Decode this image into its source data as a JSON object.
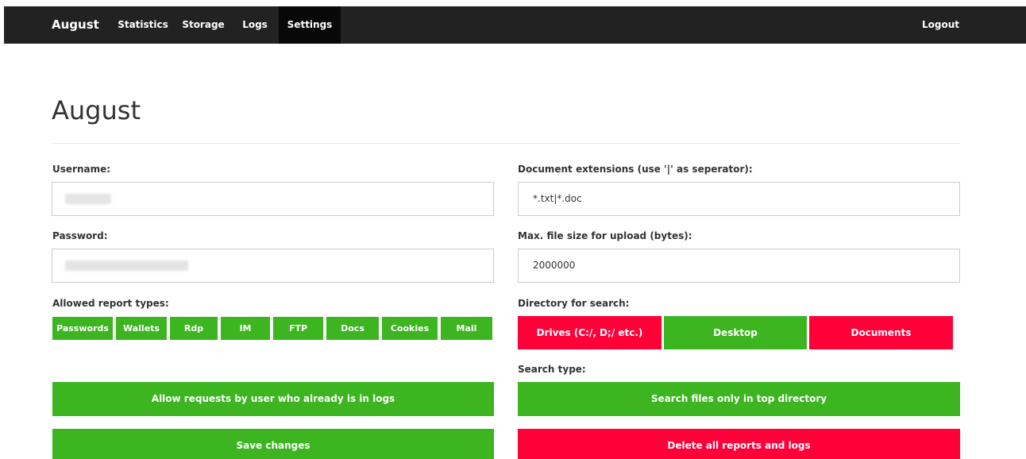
{
  "navbar": {
    "brand": "August",
    "links": [
      {
        "label": "Statistics",
        "active": false
      },
      {
        "label": "Storage",
        "active": false
      },
      {
        "label": "Logs",
        "active": false
      },
      {
        "label": "Settings",
        "active": true
      }
    ],
    "logout": "Logout"
  },
  "page": {
    "title": "August"
  },
  "left": {
    "username_label": "Username:",
    "password_label": "Password:",
    "report_types_label": "Allowed report types:",
    "report_types": [
      {
        "label": "Passwords",
        "enabled": true
      },
      {
        "label": "Wallets",
        "enabled": true
      },
      {
        "label": "Rdp",
        "enabled": true
      },
      {
        "label": "IM",
        "enabled": true
      },
      {
        "label": "FTP",
        "enabled": true
      },
      {
        "label": "Docs",
        "enabled": true
      },
      {
        "label": "Cookies",
        "enabled": true
      },
      {
        "label": "Mail",
        "enabled": true
      }
    ],
    "allow_requests_button": "Allow requests by user who already is in logs",
    "save_button": "Save changes"
  },
  "right": {
    "doc_ext_label": "Document extensions (use '|' as seperator):",
    "doc_ext_value": "*.txt|*.doc",
    "max_size_label": "Max. file size for upload (bytes):",
    "max_size_value": "2000000",
    "directory_label": "Directory for search:",
    "directories": [
      {
        "label": "Drives (C:/, D;/ etc.)",
        "enabled": false
      },
      {
        "label": "Desktop",
        "enabled": true
      },
      {
        "label": "Documents",
        "enabled": false
      }
    ],
    "search_type_label": "Search type:",
    "search_type_button": "Search files only in top directory",
    "delete_button": "Delete all reports and logs"
  },
  "colors": {
    "green": "#3cb521",
    "red": "#ff0039",
    "navbar": "#222222"
  }
}
